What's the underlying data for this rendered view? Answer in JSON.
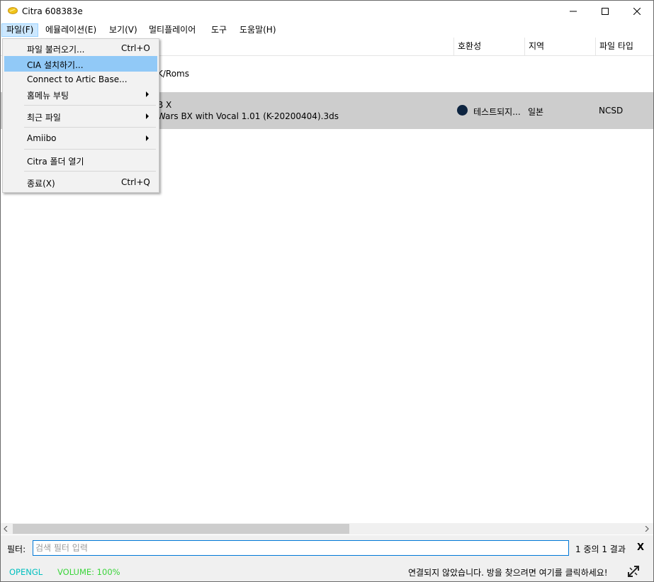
{
  "window": {
    "title": "Citra 608383e",
    "controls": [
      "minimize-icon",
      "maximize-icon",
      "close-icon"
    ]
  },
  "menubar": [
    {
      "label": "파일(F)"
    },
    {
      "label": "에뮬레이션(E)"
    },
    {
      "label": "보기(V)"
    },
    {
      "label": "멀티플레이어"
    },
    {
      "label": "도구"
    },
    {
      "label": "도움말(H)"
    }
  ],
  "file_menu": {
    "items": [
      {
        "label": "파일 불러오기...",
        "shortcut": "Ctrl+O"
      },
      {
        "label": "CIA 설치하기..."
      },
      {
        "label": "Connect to Artic Base..."
      },
      {
        "label": "홈메뉴 부팅",
        "submenu": true
      },
      {
        "label": "최근 파일",
        "submenu": true
      },
      {
        "label": "Amiibo",
        "submenu": true
      },
      {
        "label": "Citra 폴더 열기"
      },
      {
        "label": "종료(X)",
        "shortcut": "Ctrl+Q"
      }
    ],
    "highlighted_index": 1
  },
  "game_list": {
    "columns": [
      "호환성",
      "지역",
      "파일 타입"
    ],
    "folder_partial": "K/Roms",
    "rows": [
      {
        "title_partial": "B X",
        "file_partial": "Wars BX with Vocal 1.01 (K-20200404).3ds",
        "compatibility": "테스트되지...",
        "region": "일본",
        "file_type": "NCSD"
      }
    ]
  },
  "filter": {
    "label": "필터:",
    "placeholder": "검색 필터 입력",
    "value": "",
    "count": "1 중의 1 결과",
    "clear_label": "X"
  },
  "status": {
    "graphics_api": "OPENGL",
    "volume": "VOLUME: 100%",
    "network": "연결되지 않았습니다. 방을 찾으려면 여기를 클릭하세요!"
  },
  "colors": {
    "menu_highlight": "#91c9f7",
    "selected_row": "#cdcdcd",
    "api_color": "#00bfbf",
    "volume_color": "#3ad43a",
    "compat_dot": "#0d2440"
  }
}
